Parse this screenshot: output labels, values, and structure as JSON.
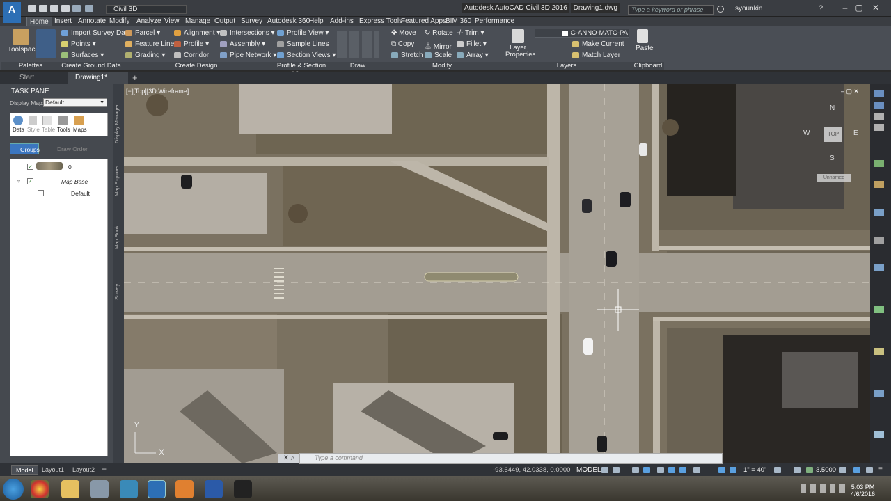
{
  "app": {
    "logo": "C3D",
    "workspace": "Civil 3D",
    "title": "Autodesk AutoCAD Civil 3D 2016",
    "document": "Drawing1.dwg",
    "search_placeholder": "Type a keyword or phrase",
    "user": "syounkin"
  },
  "menu": {
    "tabs": [
      "Home",
      "Insert",
      "Annotate",
      "Modify",
      "Analyze",
      "View",
      "Manage",
      "Output",
      "Survey",
      "Autodesk 360",
      "Help",
      "Add-ins",
      "Express Tools",
      "Featured Apps",
      "BIM 360",
      "Performance"
    ],
    "active": "Home"
  },
  "ribbon": {
    "toolspace": "Toolspace",
    "ground": [
      "Import Survey Data",
      "Points",
      "Surfaces"
    ],
    "design1": [
      "Parcel",
      "Feature Line",
      "Grading"
    ],
    "design2": [
      "Alignment",
      "Profile",
      "Corridor"
    ],
    "design3": [
      "Intersections",
      "Assembly",
      "Pipe Network"
    ],
    "profile": [
      "Profile View",
      "Sample Lines",
      "Section Views"
    ],
    "modify1": [
      "Move",
      "Copy",
      "Stretch"
    ],
    "modify2": [
      "Rotate",
      "Mirror",
      "Scale"
    ],
    "modify3": [
      "Trim",
      "Fillet",
      "Array"
    ],
    "layer_props": "Layer Properties",
    "current_layer": "C-ANNO-MATC-PA",
    "layers": [
      "Make Current",
      "Match Layer"
    ],
    "paste": "Paste",
    "panels": [
      "Palettes",
      "Create Ground Data",
      "Create Design",
      "Profile & Section Views",
      "Draw",
      "Modify",
      "Layers",
      "Clipboard"
    ]
  },
  "filetabs": {
    "start": "Start",
    "drawing": "Drawing1*"
  },
  "taskpane": {
    "title": "TASK PANE",
    "display_map_label": "Display Map:",
    "display_map_value": "Default",
    "tools": [
      "Data",
      "Style",
      "Table",
      "Tools",
      "Maps"
    ],
    "groups_btn": "Groups",
    "draw_order_btn": "Draw Order",
    "tree": [
      {
        "label": "0",
        "checked": true
      },
      {
        "label": "Map Base",
        "checked": true
      },
      {
        "label": "Default",
        "checked": false
      }
    ],
    "side_tabs": [
      "Display Manager",
      "Map Explorer",
      "Map Book",
      "Survey"
    ]
  },
  "viewport": {
    "label": "[−][Top][3D Wireframe]",
    "viewcube": {
      "top": "TOP",
      "n": "N",
      "s": "S",
      "e": "E",
      "w": "W",
      "wcs": "Unnamed"
    },
    "ucs_x": "X",
    "ucs_y": "Y"
  },
  "command": {
    "placeholder": "Type a command"
  },
  "layout_tabs": [
    "Model",
    "Layout1",
    "Layout2"
  ],
  "status": {
    "coords": "-93.6449, 42.0338, 0.0000",
    "space": "MODEL",
    "scale": "1\" = 40'",
    "annotation_value": "3.5000"
  },
  "clock": {
    "time": "5:03 PM",
    "date": "4/6/2016"
  },
  "colors": {
    "accent": "#3b76c0",
    "ribbon": "#4a4e55",
    "title": "#3a3d42"
  }
}
